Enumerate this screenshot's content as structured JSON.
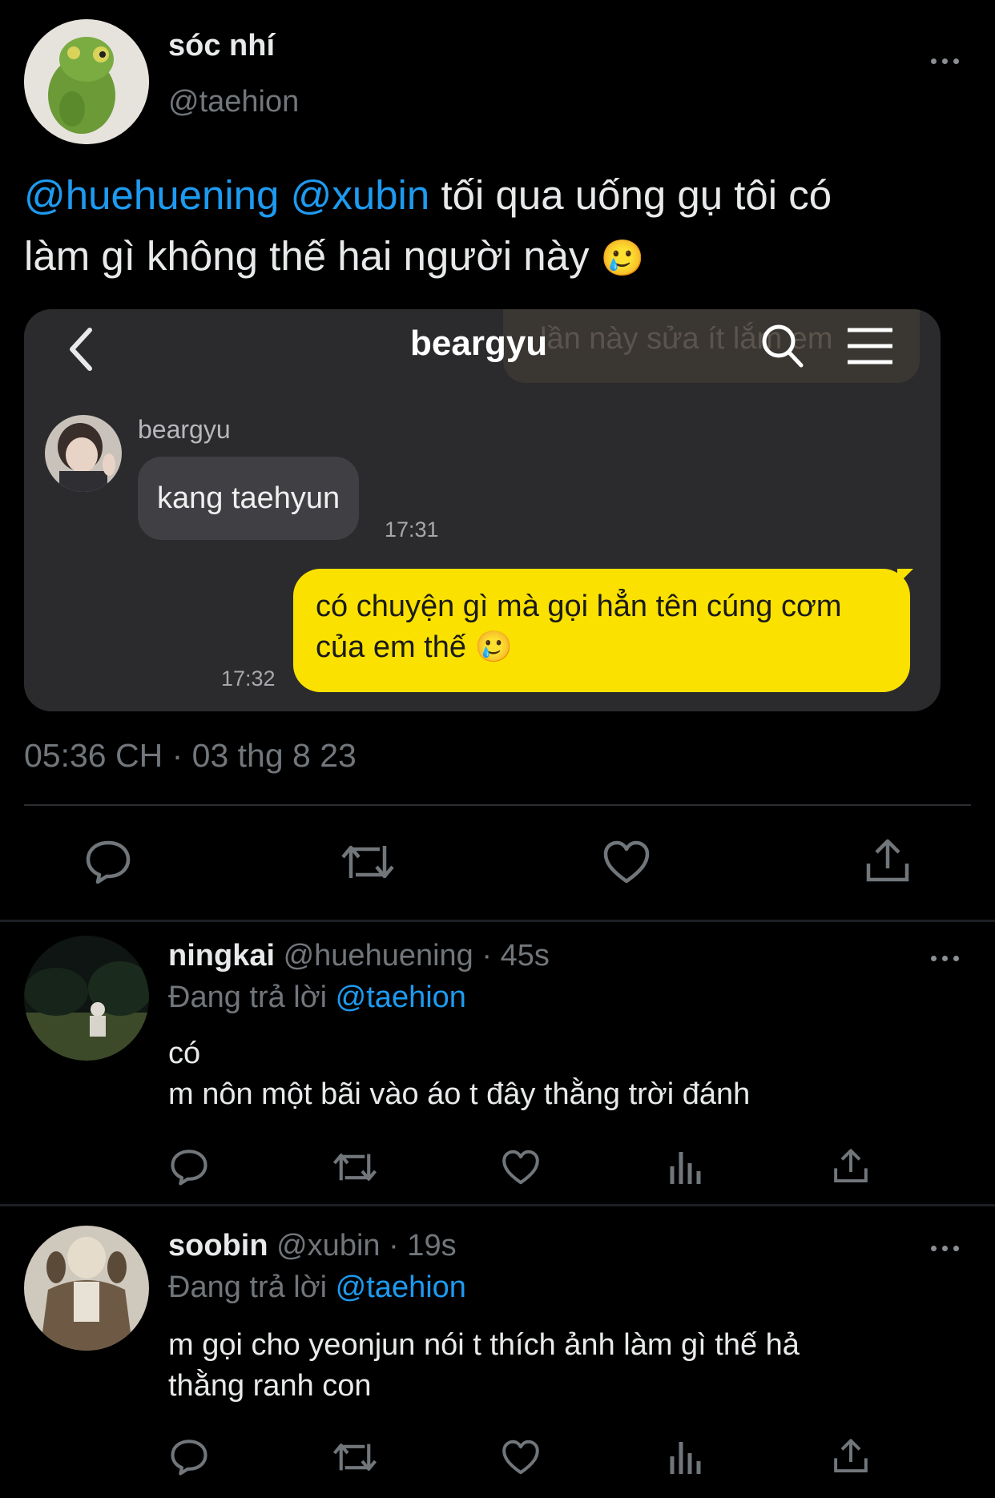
{
  "main_tweet": {
    "display_name": "sóc nhí",
    "handle": "@taehion",
    "mention_1": "@huehuening",
    "mention_2": "@xubin",
    "text_line1": "tối qua uống gụ tôi có",
    "text_line2": "làm gì không thế hai người này",
    "emoji": "🥲",
    "timestamp": "05:36 CH · 03 thg 8 23"
  },
  "chat_screenshot": {
    "title": "beargyu",
    "ghost_text": "lần này sửa ít lắm em",
    "sender_name": "beargyu",
    "incoming_message": "kang taehyun",
    "incoming_time": "17:31",
    "outgoing_line1": "có chuyện gì mà gọi hẳn tên cúng cơm",
    "outgoing_line2": "của em thế",
    "outgoing_emoji": "🥲",
    "outgoing_time": "17:32",
    "bubble_color": "#fae100"
  },
  "replies": [
    {
      "display_name": "ningkai",
      "handle": "@huehuening",
      "time": "· 45s",
      "replying_label": "Đang trả lời",
      "replying_to": "@taehion",
      "text_line1": "có",
      "text_line2": "m nôn một bãi vào áo t đây thằng trời đánh"
    },
    {
      "display_name": "soobin",
      "handle": "@xubin",
      "time": "· 19s",
      "replying_label": "Đang trả lời",
      "replying_to": "@taehion",
      "text_line1": "m gọi cho yeonjun nói t thích ảnh làm gì thế hả",
      "text_line2": "thằng ranh con"
    }
  ],
  "colors": {
    "background": "#000000",
    "text": "#e7e9ea",
    "muted": "#71767b",
    "link": "#1d9bf0",
    "card": "#2b2b2e"
  },
  "icons": [
    "more-icon",
    "back-arrow-icon",
    "search-icon",
    "menu-icon",
    "reply-icon",
    "retweet-icon",
    "like-icon",
    "share-icon",
    "views-icon"
  ]
}
